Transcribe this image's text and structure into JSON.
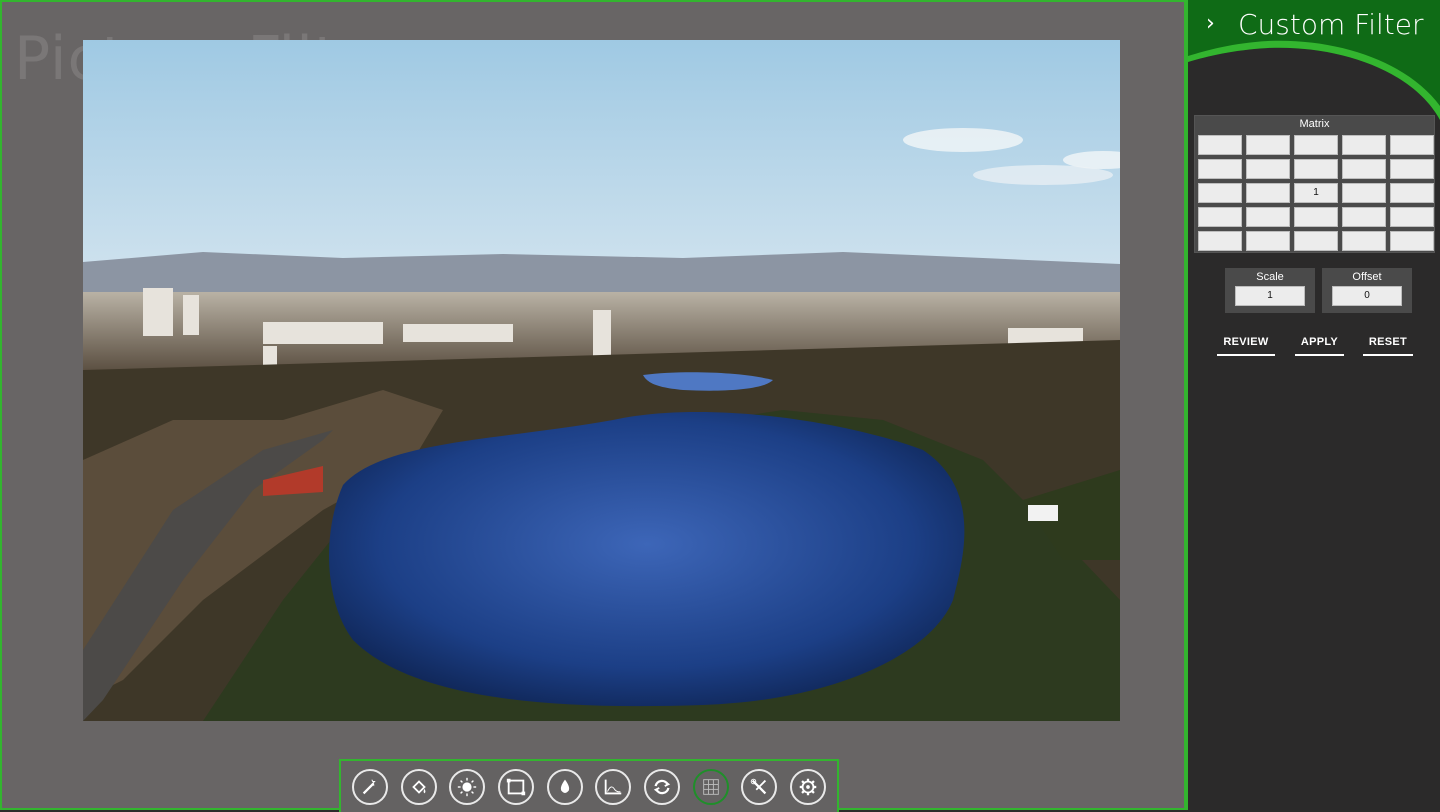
{
  "app": {
    "background_title": "Picture Filter"
  },
  "panel": {
    "title": "Custom Filter",
    "back_icon": "chevron-right-icon",
    "matrix": {
      "label": "Matrix",
      "rows": [
        [
          "",
          "",
          "",
          "",
          ""
        ],
        [
          "",
          "",
          "",
          "",
          ""
        ],
        [
          "",
          "",
          "1",
          "",
          ""
        ],
        [
          "",
          "",
          "",
          "",
          ""
        ],
        [
          "",
          "",
          "",
          "",
          ""
        ]
      ]
    },
    "scale": {
      "label": "Scale",
      "value": "1"
    },
    "offset": {
      "label": "Offset",
      "value": "0"
    },
    "buttons": {
      "review": "REVIEW",
      "apply": "APPLY",
      "reset": "RESET"
    }
  },
  "toolbar": {
    "tools": [
      {
        "icon": "magic-wand-icon"
      },
      {
        "icon": "paint-bucket-icon"
      },
      {
        "icon": "brightness-icon"
      },
      {
        "icon": "crop-frame-icon"
      },
      {
        "icon": "water-drop-icon"
      },
      {
        "icon": "histogram-icon"
      },
      {
        "icon": "refresh-icon"
      },
      {
        "icon": "grid-icon",
        "active": true
      },
      {
        "icon": "wrench-screwdriver-icon"
      },
      {
        "icon": "settings-gear-icon"
      }
    ]
  },
  "colors": {
    "accent": "#33b52f",
    "accent_dark": "#0f6b16",
    "panel_bg": "#2b2a2a",
    "stage_bg": "#686565"
  }
}
